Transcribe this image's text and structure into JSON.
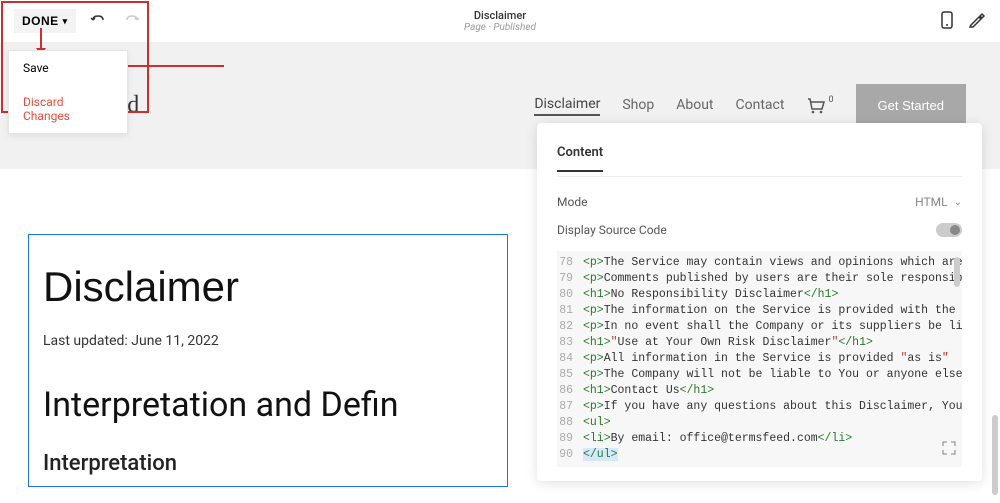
{
  "topbar": {
    "done_label": "DONE",
    "title": "Disclaimer",
    "subtitle": "Page · Published"
  },
  "dropdown": {
    "save": "Save",
    "discard": "Discard Changes"
  },
  "nav": {
    "items": [
      "Disclaimer",
      "Shop",
      "About",
      "Contact"
    ],
    "cart_count": "0",
    "cta": "Get Started"
  },
  "logo_suffix": "eed",
  "doc": {
    "title": "Disclaimer",
    "updated": "Last updated: June 11, 2022",
    "h2": "Interpretation and Defin",
    "h3": "Interpretation"
  },
  "panel": {
    "tab": "Content",
    "mode_label": "Mode",
    "mode_value": "HTML",
    "source_label": "Display Source Code"
  },
  "code": {
    "lines": [
      {
        "n": "78",
        "pre": "<p>",
        "body": "The Service may contain views and opinions which are those "
      },
      {
        "n": "79",
        "pre": "<p>",
        "body": "Comments published by users are their sole responsibility a"
      },
      {
        "n": "80",
        "pre": "<h1>",
        "body": "No Responsibility Disclaimer",
        "post": "</h1>"
      },
      {
        "n": "81",
        "pre": "<p>",
        "body": "The information on the Service is provided with the underst"
      },
      {
        "n": "82",
        "pre": "<p>",
        "body": "In no event shall the Company or its suppliers be liable fo"
      },
      {
        "n": "83",
        "pre": "<h1>",
        "ent1": "&quot;",
        "body": "Use at Your Own Risk",
        "ent2": "&quot;",
        "body2": " Disclaimer",
        "post": "</h1>"
      },
      {
        "n": "84",
        "pre": "<p>",
        "body": "All information in the Service is provided ",
        "ent1": "&quot;",
        "body2": "as is",
        "ent2": "&quot"
      },
      {
        "n": "85",
        "pre": "<p>",
        "body": "The Company will not be liable to You or anyone else for an"
      },
      {
        "n": "86",
        "pre": "<h1>",
        "body": "Contact Us",
        "post": "</h1>"
      },
      {
        "n": "87",
        "pre": "<p>",
        "body": "If you have any questions about this Disclaimer, You can co"
      },
      {
        "n": "88",
        "pre": "<ul>",
        "body": ""
      },
      {
        "n": "89",
        "pre": "<li>",
        "body": "By email: office@termsfeed.com",
        "post": "</li>"
      },
      {
        "n": "90",
        "pre_hl": "</ul>",
        "body": ""
      }
    ]
  }
}
